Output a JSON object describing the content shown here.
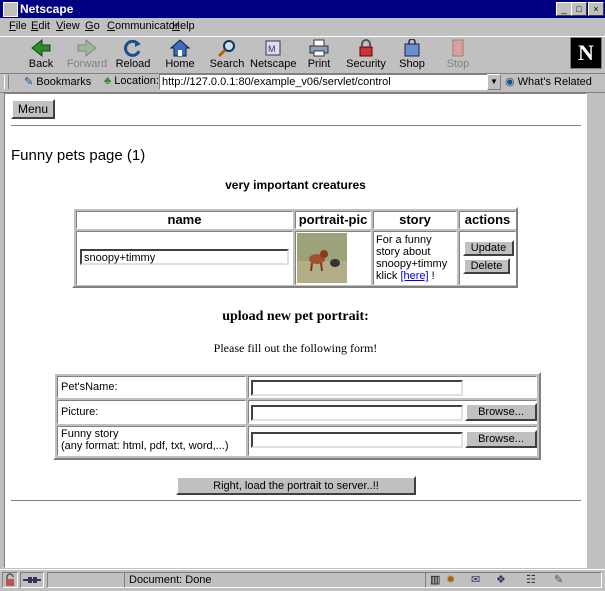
{
  "window": {
    "title": "Netscape"
  },
  "menubar": [
    {
      "underline": "F",
      "rest": "ile"
    },
    {
      "underline": "E",
      "rest": "dit"
    },
    {
      "underline": "V",
      "rest": "iew"
    },
    {
      "underline": "G",
      "rest": "o"
    },
    {
      "underline": "C",
      "rest": "ommunicator"
    },
    {
      "underline": "H",
      "rest": "elp"
    }
  ],
  "toolbar": {
    "back": "Back",
    "forward": "Forward",
    "reload": "Reload",
    "home": "Home",
    "search": "Search",
    "netscape": "Netscape",
    "print": "Print",
    "security": "Security",
    "shop": "Shop",
    "stop": "Stop"
  },
  "location_bar": {
    "bookmarks": "Bookmarks",
    "location_label": "Location:",
    "url": "http://127.0.0.1:80/example_v06/servlet/control",
    "whats_related": "What's Related"
  },
  "page": {
    "menu_button": "Menu",
    "heading": "Funny pets page (1)",
    "subheading": "very important creatures",
    "table": {
      "headers": [
        "name",
        "portrait-pic",
        "story",
        "actions"
      ],
      "row": {
        "name_value": "snoopy+timmy",
        "story_text": "For a funny story about snoopy+timmy klick",
        "story_link": "[here]",
        "story_suffix": "!",
        "update_button": "Update",
        "delete_button": "Delete"
      }
    },
    "upload_title": "upload new pet portrait:",
    "upload_instructions": "Please fill out the following form!",
    "form": {
      "pets_name_label": "Pet'sName:",
      "picture_label": "Picture:",
      "story_label_line1": "Funny story",
      "story_label_line2": "(any format: html, pdf, txt, word,...)",
      "browse_label": "Browse...",
      "pets_name_value": "",
      "picture_value": "",
      "story_value": ""
    },
    "submit_button": "Right, load the portrait to server..!!"
  },
  "statusbar": {
    "status": "Document: Done"
  },
  "colors": {
    "titlebar": "#000080",
    "chrome": "#c0c0c0",
    "link": "#0000ee"
  }
}
